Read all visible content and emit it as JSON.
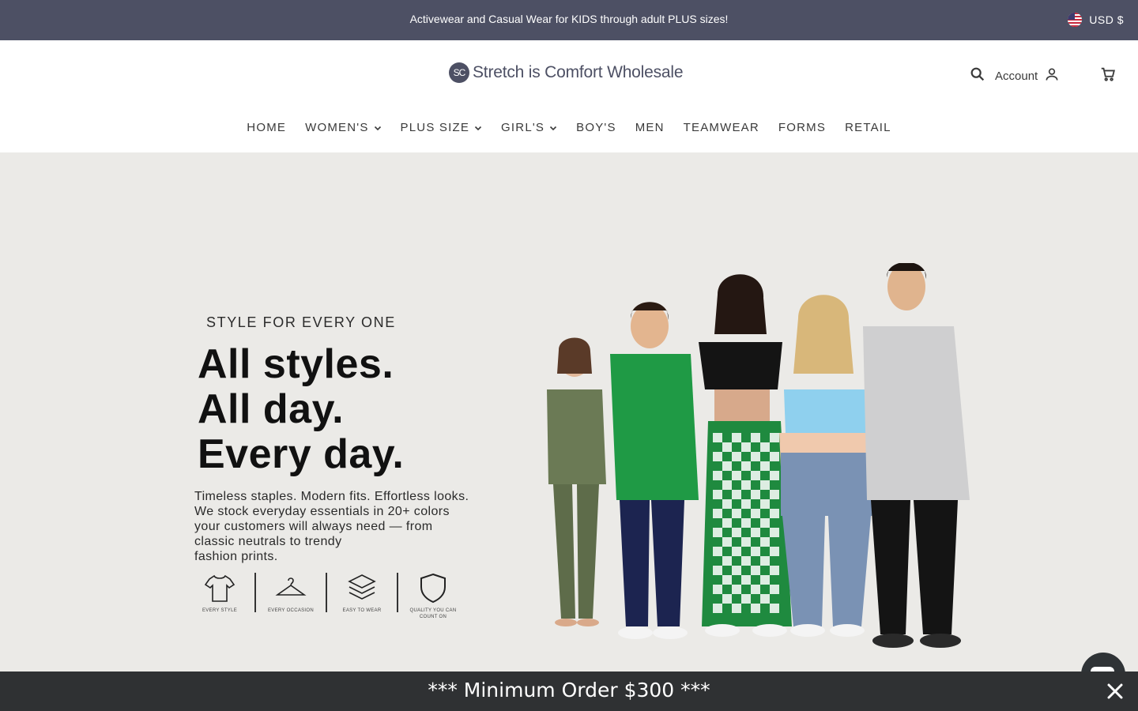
{
  "announcement": {
    "text": "Activewear and Casual Wear for KIDS through adult PLUS sizes!"
  },
  "currency": {
    "label": "USD $",
    "flag_icon": "us-flag-icon"
  },
  "header": {
    "logo_mark": "SC",
    "logo_text": "Stretch is Comfort Wholesale",
    "account_label": "Account",
    "icons": [
      "search-icon",
      "user-icon",
      "cart-icon"
    ]
  },
  "nav": {
    "items": [
      {
        "label": "HOME",
        "dropdown": false
      },
      {
        "label": "WOMEN'S",
        "dropdown": true
      },
      {
        "label": "PLUS SIZE",
        "dropdown": true
      },
      {
        "label": "GIRL'S",
        "dropdown": true
      },
      {
        "label": "BOY'S",
        "dropdown": false
      },
      {
        "label": "MEN",
        "dropdown": false
      },
      {
        "label": "TEAMWEAR",
        "dropdown": false
      },
      {
        "label": "FORMS",
        "dropdown": false
      },
      {
        "label": "RETAIL",
        "dropdown": false
      }
    ]
  },
  "hero": {
    "eyebrow": "STYLE FOR EVERY ONE",
    "headline": [
      "All styles.",
      "All day.",
      "Every day."
    ],
    "body_lines": [
      "Timeless staples. Modern fits. Effortless looks.",
      "We stock everyday essentials in 20+ colors",
      "your customers will always need — from",
      "classic neutrals to trendy",
      "fashion prints."
    ],
    "features": [
      {
        "icon": "tshirt-icon",
        "label": "EVERY STYLE"
      },
      {
        "icon": "hanger-icon",
        "label": "EVERY OCCASION"
      },
      {
        "icon": "layers-icon",
        "label": "EASY TO WEAR"
      },
      {
        "icon": "shield-icon",
        "label": "QUALITY YOU CAN COUNT ON"
      }
    ],
    "background_color": "#ebeae7"
  },
  "min_order": {
    "text": "*** Minimum Order $300 ***",
    "close_icon": "close-icon"
  },
  "colors": {
    "announcement_bg": "#4d5064",
    "bottom_bar_bg": "#2f3133",
    "nav_text": "#3a3a3a"
  }
}
